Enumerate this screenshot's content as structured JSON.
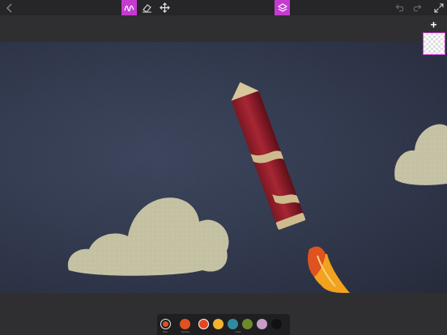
{
  "toolbar": {
    "back_icon": "chevron-left-icon",
    "draw_icon": "scribble-icon",
    "erase_icon": "eraser-icon",
    "move_icon": "move-arrows-icon",
    "layers_icon": "layers-icon",
    "undo_icon": "undo-icon",
    "redo_icon": "redo-icon",
    "fullscreen_icon": "expand-icon",
    "accent_color": "#c53bd0"
  },
  "layers": {
    "add_icon": "plus-icon",
    "selected_layer": "transparent"
  },
  "palette": {
    "brush_label": "Size",
    "opacity_label": "Opacity",
    "color_label": "Color",
    "brush_color": "#e0521f",
    "swatches": [
      {
        "name": "red-orange",
        "color": "#e0521f",
        "selected": false
      },
      {
        "name": "orange",
        "color": "#e4471e",
        "selected": true
      },
      {
        "name": "yellow",
        "color": "#f2b333",
        "selected": false
      },
      {
        "name": "teal",
        "color": "#2f8ba0",
        "selected": false
      },
      {
        "name": "olive-green",
        "color": "#6d8a2a",
        "selected": false
      },
      {
        "name": "lilac",
        "color": "#c79cc7",
        "selected": false
      },
      {
        "name": "black",
        "color": "#111111",
        "selected": false
      }
    ]
  }
}
